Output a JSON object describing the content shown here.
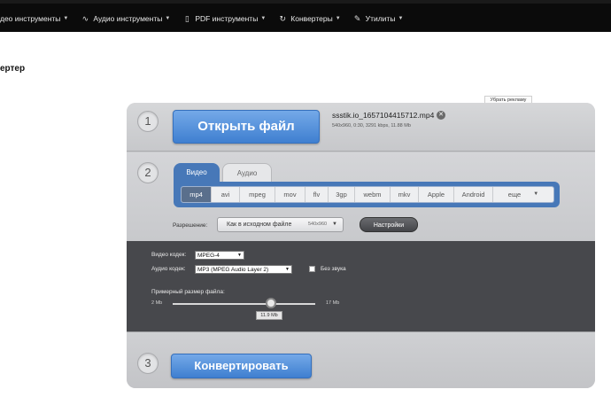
{
  "nav": {
    "items": [
      {
        "label": "део инструменты",
        "icon": "video-camera-icon"
      },
      {
        "label": "Аудио инструменты",
        "icon": "audio-wave-icon"
      },
      {
        "label": "PDF инструменты",
        "icon": "document-icon"
      },
      {
        "label": "Конвертеры",
        "icon": "refresh-icon"
      },
      {
        "label": "Утилиты",
        "icon": "wrench-icon"
      }
    ]
  },
  "page": {
    "title": "ертер"
  },
  "ad": {
    "hide_label": "Убрать рекламу"
  },
  "step1": {
    "number": "1",
    "open_button": "Открыть файл",
    "file_name": "ssstik.io_1657104415712.mp4",
    "file_meta": "540x960, 0:30, 3291 kbps, 11.88 Mb",
    "remove_glyph": "✕"
  },
  "step2": {
    "number": "2",
    "tabs": [
      "Видео",
      "Аудио"
    ],
    "formats": [
      "mp4",
      "avi",
      "mpeg",
      "mov",
      "flv",
      "3gp",
      "webm",
      "mkv",
      "Apple",
      "Android",
      "еще"
    ],
    "selected_format": "mp4",
    "resolution_label": "Разрешение:",
    "resolution_value": "Как в исходном файле",
    "resolution_dims": "540x960",
    "settings_button": "Настройки"
  },
  "step3": {
    "video_codec_label": "Видео кодек:",
    "video_codec_value": "MPEG-4",
    "audio_codec_label": "Аудио кодек:",
    "audio_codec_value": "MP3 (MPEG Audio Layer 2)",
    "no_sound_label": "Без звука",
    "no_sound_checked": false,
    "size_label": "Примерный размер файла:",
    "size_min": "2 Mb",
    "size_max": "17 Mb",
    "size_value": "11.9 Mb"
  },
  "step4": {
    "number": "3",
    "convert_button": "Конвертировать"
  }
}
